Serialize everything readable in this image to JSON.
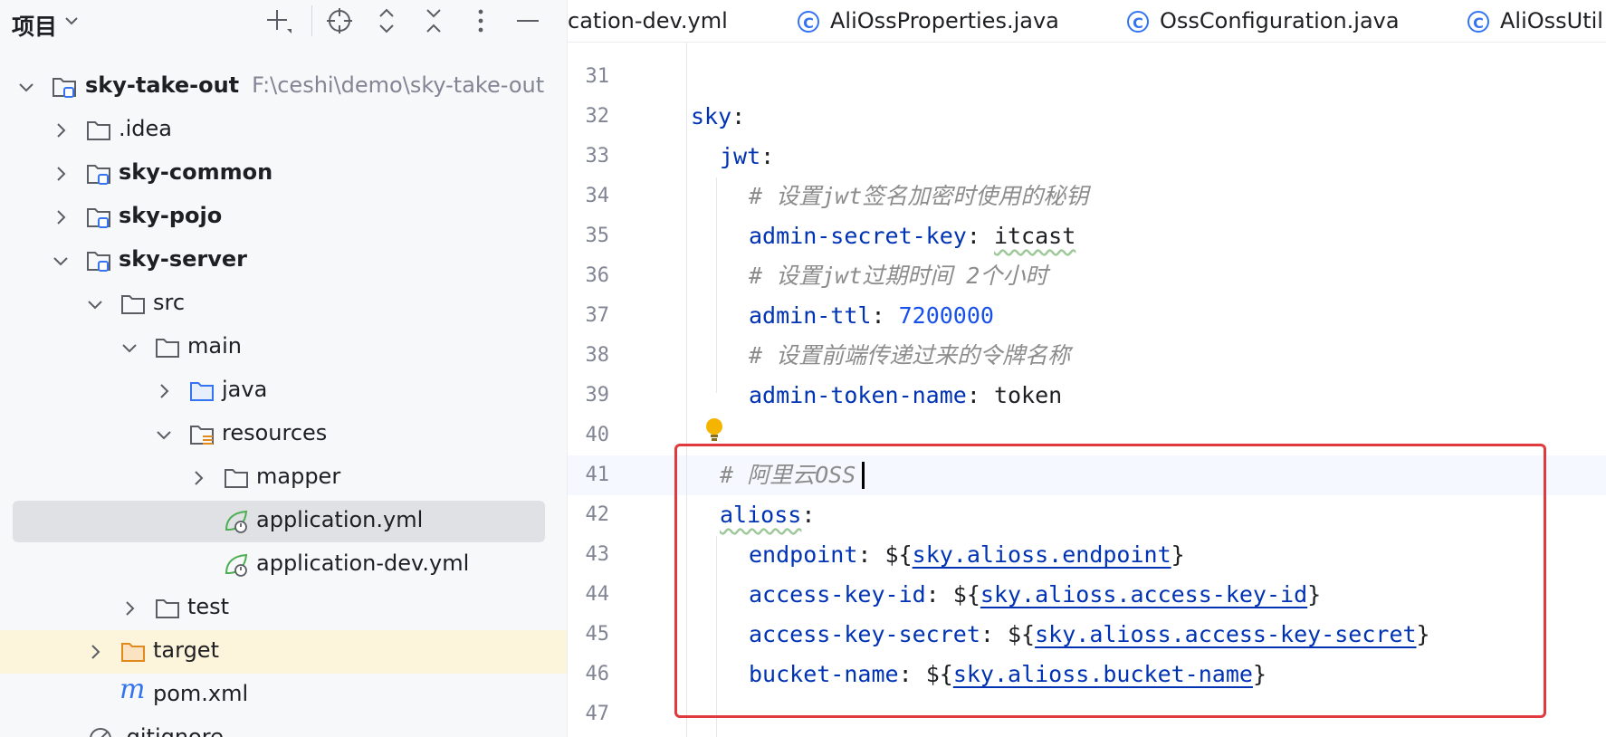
{
  "project_panel": {
    "title": "项目",
    "tree": [
      {
        "label": "sky-take-out",
        "path": "F:\\ceshi\\demo\\sky-take-out",
        "bold": true,
        "icon": "module-folder-icon",
        "expanded": true
      },
      {
        "label": ".idea",
        "icon": "folder-icon"
      },
      {
        "label": "sky-common",
        "bold": true,
        "icon": "module-folder-icon"
      },
      {
        "label": "sky-pojo",
        "bold": true,
        "icon": "module-folder-icon"
      },
      {
        "label": "sky-server",
        "bold": true,
        "icon": "module-folder-icon",
        "expanded": true
      },
      {
        "label": "src",
        "icon": "folder-icon",
        "expanded": true
      },
      {
        "label": "main",
        "icon": "folder-icon",
        "expanded": true
      },
      {
        "label": "java",
        "icon": "source-folder-icon"
      },
      {
        "label": "resources",
        "icon": "resources-folder-icon",
        "expanded": true
      },
      {
        "label": "mapper",
        "icon": "folder-icon"
      },
      {
        "label": "application.yml",
        "icon": "spring-yaml-icon",
        "selected": true
      },
      {
        "label": "application-dev.yml",
        "icon": "spring-yaml-icon"
      },
      {
        "label": "test",
        "icon": "folder-icon"
      },
      {
        "label": "target",
        "icon": "excluded-folder-icon"
      },
      {
        "label": "pom.xml",
        "icon": "maven-icon"
      },
      {
        "label": ".gitignore",
        "icon": "ignore-file-icon"
      }
    ]
  },
  "editor": {
    "tabs": [
      {
        "label": "cation-dev.yml",
        "icon": "yaml-icon"
      },
      {
        "label": "AliOssProperties.java",
        "icon": "class-icon",
        "glyph": "C"
      },
      {
        "label": "OssConfiguration.java",
        "icon": "class-icon",
        "glyph": "C"
      },
      {
        "label": "AliOssUtil",
        "icon": "class-icon",
        "glyph": "C"
      }
    ],
    "line_numbers": [
      "31",
      "32",
      "33",
      "34",
      "35",
      "36",
      "37",
      "38",
      "39",
      "40",
      "41",
      "42",
      "43",
      "44",
      "45",
      "46",
      "47"
    ],
    "code": {
      "l32_key": "sky",
      "l33_key": "jwt",
      "l34_comment": "# 设置jwt签名加密时使用的秘钥",
      "l35_key": "admin-secret-key",
      "l35_value": "itcast",
      "l36_comment": "# 设置jwt过期时间 2个小时",
      "l37_key": "admin-ttl",
      "l37_value": "7200000",
      "l38_comment": "# 设置前端传递过来的令牌名称",
      "l39_key": "admin-token-name",
      "l39_value": "token",
      "l41_comment": "# 阿里云OSS",
      "l42_key": "alioss",
      "l43_key": "endpoint",
      "l43_ref": "sky.alioss.endpoint",
      "l44_key": "access-key-id",
      "l44_ref": "sky.alioss.access-key-id",
      "l45_key": "access-key-secret",
      "l45_ref": "sky.alioss.access-key-secret",
      "l46_key": "bucket-name",
      "l46_ref": "sky.alioss.bucket-name",
      "colon": ":",
      "ref_open": "${",
      "ref_close": "}"
    }
  },
  "colors": {
    "accent": "#3574f0",
    "highlight_box": "#e0393e",
    "yaml_key": "#0033b3",
    "comment": "#8c8c8c"
  }
}
